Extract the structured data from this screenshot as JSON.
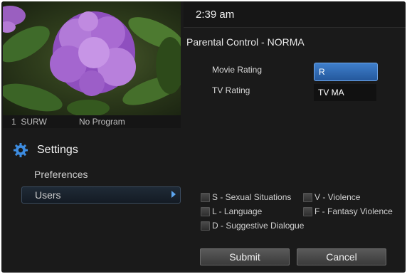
{
  "channel": {
    "number": "1",
    "callsign": "SURW",
    "program": "No Program"
  },
  "clock": {
    "time": "2:39 am"
  },
  "sidebar": {
    "title": "Settings",
    "items": [
      {
        "label": "Preferences"
      },
      {
        "label": "Users"
      }
    ]
  },
  "panel": {
    "title": "Parental Control - NORMA",
    "fields": [
      {
        "label": "Movie Rating",
        "value": "R"
      },
      {
        "label": "TV Rating",
        "value": "TV MA"
      }
    ],
    "content_flags": [
      {
        "label": "S - Sexual Situations"
      },
      {
        "label": "V - Violence"
      },
      {
        "label": "L - Language"
      },
      {
        "label": "F - Fantasy Violence"
      },
      {
        "label": "D - Suggestive Dialogue"
      }
    ],
    "submit_label": "Submit",
    "cancel_label": "Cancel"
  },
  "colors": {
    "accent": "#3f7fcc",
    "background": "#1a1a1a",
    "arrow": "#5da6f0"
  }
}
